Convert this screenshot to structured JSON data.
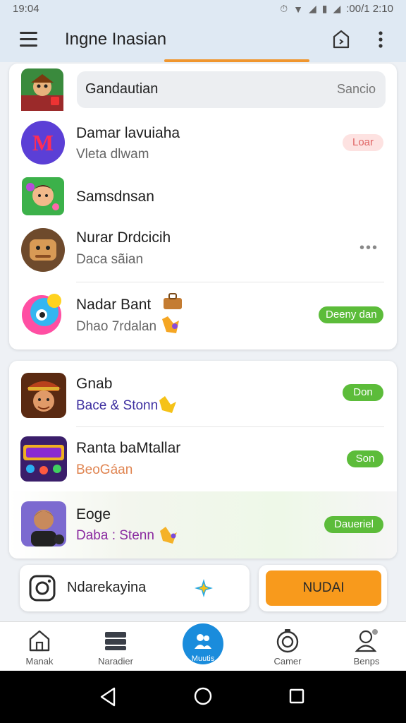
{
  "status_bar": {
    "time": "19:04",
    "right_text": ":00/1 2:10"
  },
  "app_bar": {
    "title": "Ingne Inasian"
  },
  "search": {
    "label": "Gandautian",
    "hint": "Sancio"
  },
  "card1_rows": [
    {
      "name": "Damar lavuiaha",
      "sub": "Vleta dlwam",
      "badge": "Loar"
    },
    {
      "name": "Samsdnsan"
    },
    {
      "name": "Nurar Drdcicih",
      "sub": "Daca sãian"
    },
    {
      "name": "Nadar Bant",
      "sub": "Dhao 7rdalan",
      "badge": "Deeny dan"
    }
  ],
  "card2_rows": [
    {
      "name": "Gnab",
      "sub": "Bace & Stonn",
      "badge": "Don"
    },
    {
      "name": "Ranta baMtallar",
      "sub": "BeoGáan",
      "badge": "Son"
    },
    {
      "name": "Eoge",
      "sub": "Daba : Stenn",
      "badge": "Daueriel"
    }
  ],
  "actions": {
    "instagram_label": "Ndarekayina",
    "primary_button": "NUDAI"
  },
  "bottom_nav": [
    {
      "label": "Manak",
      "icon": "home-icon"
    },
    {
      "label": "Naradier",
      "icon": "layers-icon"
    },
    {
      "label": "Muutis",
      "icon": "people-icon"
    },
    {
      "label": "Camer",
      "icon": "camera-icon"
    },
    {
      "label": "Benps",
      "icon": "person-icon"
    }
  ],
  "colors": {
    "accent": "#f0962e",
    "badge_green": "#5cbc3a",
    "button_orange": "#f89a1c",
    "fab_blue": "#1a8cdc"
  }
}
